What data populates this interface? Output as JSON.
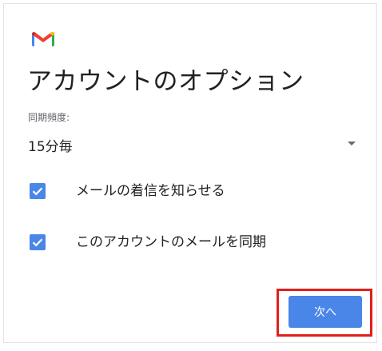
{
  "logo": {
    "icon": "gmail-logo-icon",
    "colors": [
      "#4285f4",
      "#ea4335",
      "#fbbc04",
      "#34a853",
      "#c5221f"
    ]
  },
  "page": {
    "title": "アカウントのオプション"
  },
  "sync": {
    "label": "同期頻度:",
    "selected": "15分毎"
  },
  "options": [
    {
      "label": "メールの着信を知らせる",
      "checked": true
    },
    {
      "label": "このアカウントのメールを同期",
      "checked": true
    }
  ],
  "actions": {
    "next_label": "次へ"
  },
  "colors": {
    "accent": "#4a86e8",
    "highlight": "#e0201c"
  }
}
